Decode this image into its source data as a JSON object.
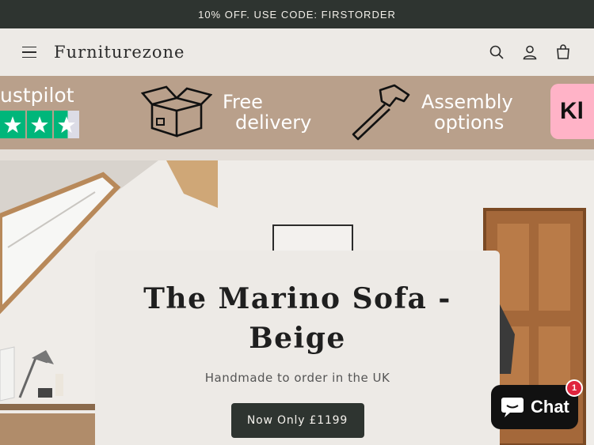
{
  "announcement": {
    "text": "10% OFF. USE CODE: FIRSTORDER"
  },
  "header": {
    "brand": "Furniturezone",
    "icons": [
      "menu-icon",
      "search-icon",
      "account-icon",
      "cart-icon"
    ]
  },
  "usp_bar": {
    "trustpilot_text": "ustpilot",
    "trustpilot_stars_shown": 3,
    "delivery_line1": "Free",
    "delivery_line2": "delivery",
    "assembly_line1": "Assembly",
    "assembly_line2": "options",
    "klarna_text": "Kl"
  },
  "hero": {
    "title": "The Marino Sofa - Beige",
    "subtitle": "Handmade to order in the UK",
    "cta_label": "Now Only £1199"
  },
  "chat": {
    "label": "Chat",
    "badge_count": "1"
  },
  "colors": {
    "dark": "#2e3430",
    "usp_bg": "#b9a08b",
    "trustpilot_green": "#00b67a",
    "klarna_pink": "#ffb3c7",
    "page_bg": "#edeae6"
  }
}
